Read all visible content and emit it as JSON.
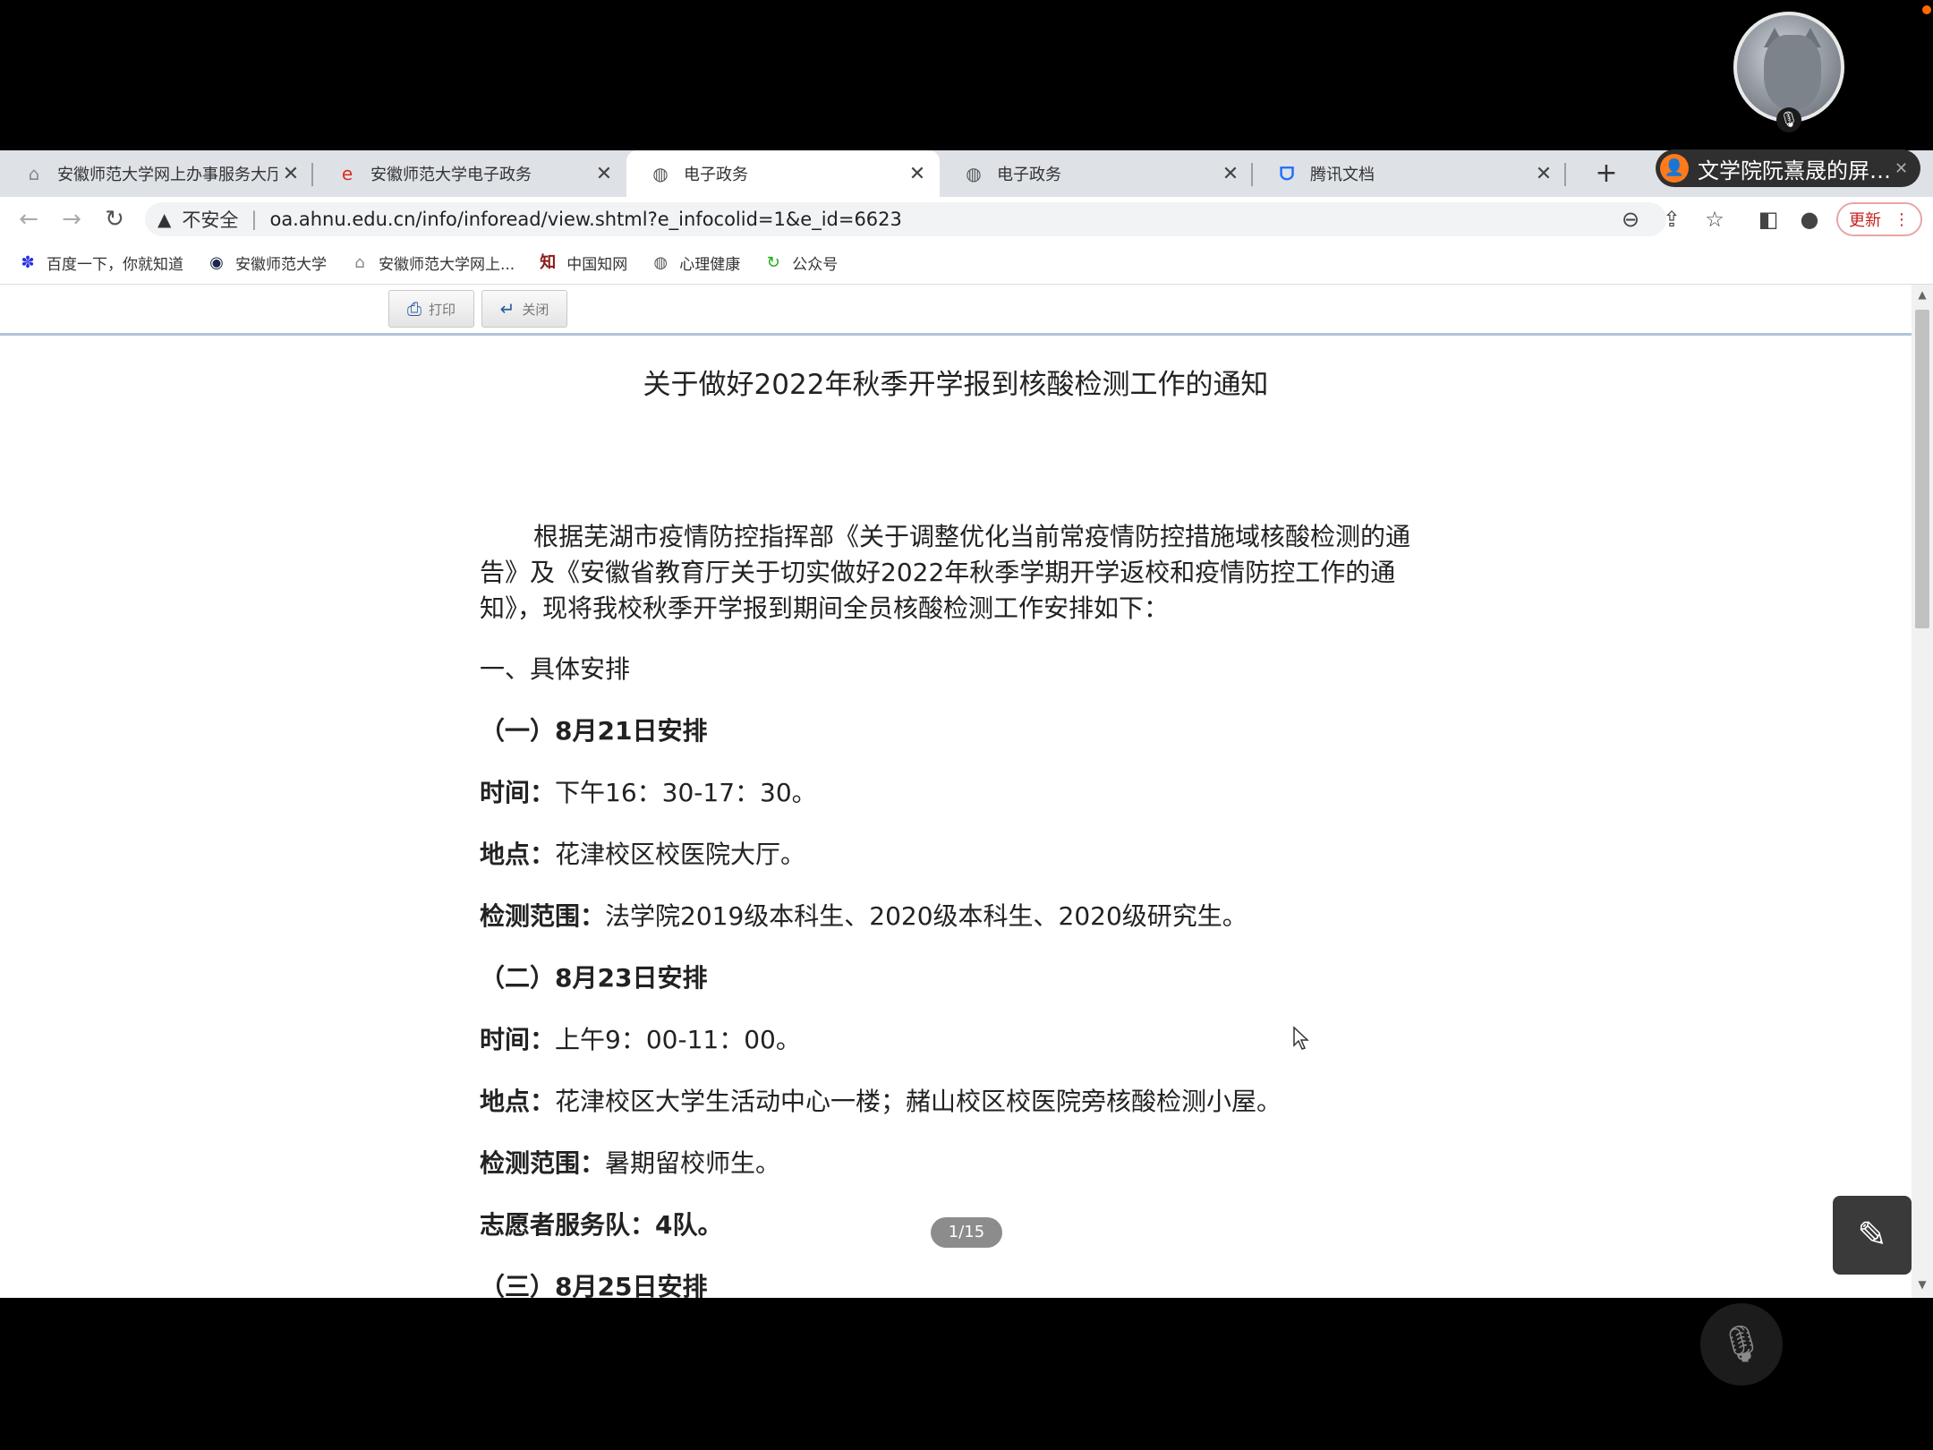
{
  "meeting": {
    "share_label": "文学院阮熹晟的屏…",
    "avatar_alt": "cat avatar",
    "pager": "1/15"
  },
  "tabs": [
    {
      "label": "安徽师范大学网上办事服务大厅",
      "icon": "home-icon",
      "close": "✕"
    },
    {
      "label": "安徽师范大学电子政务",
      "icon": "swirl-logo-icon",
      "close": "✕"
    },
    {
      "label": "电子政务",
      "icon": "globe-icon",
      "close": "✕"
    },
    {
      "label": "电子政务",
      "icon": "globe-icon",
      "close": "✕"
    },
    {
      "label": "腾讯文档",
      "icon": "tencent-docs-icon",
      "close": "✕"
    }
  ],
  "newtab_label": "+",
  "toolbar": {
    "insecure_label": "不安全",
    "url": "oa.ahnu.edu.cn/info/inforead/view.shtml?e_infocolid=1&e_id=6623",
    "update_label": "更新"
  },
  "bookmarks": [
    {
      "label": "百度一下，你就知道",
      "icon": "baidu-paw-icon"
    },
    {
      "label": "安徽师范大学",
      "icon": "university-seal-icon"
    },
    {
      "label": "安徽师范大学网上...",
      "icon": "home-icon"
    },
    {
      "label": "中国知网",
      "icon": "cnki-icon"
    },
    {
      "label": "心理健康",
      "icon": "globe-icon"
    },
    {
      "label": "公众号",
      "icon": "green-swirl-icon"
    }
  ],
  "page": {
    "print_label": "打印",
    "close_label": "关闭",
    "title": "关于做好2022年秋季开学报到核酸检测工作的通知",
    "intro": "根据芜湖市疫情防控指挥部《关于调整优化当前常疫情防控措施域核酸检测的通告》及《安徽省教育厅关于切实做好2022年秋季学期开学返校和疫情防控工作的通知》，现将我校秋季开学报到期间全员核酸检测工作安排如下：",
    "section1": "一、具体安排",
    "s1_head": "（一）8月21日安排",
    "s1_time_label": "时间：",
    "s1_time": "下午16：30-17：30。",
    "s1_place_label": "地点：",
    "s1_place": "花津校区校医院大厅。",
    "s1_scope_label": "检测范围：",
    "s1_scope": "法学院2019级本科生、2020级本科生、2020级研究生。",
    "s2_head": "（二）8月23日安排",
    "s2_time_label": "时间：",
    "s2_time": "上午9：00-11：00。",
    "s2_place_label": "地点：",
    "s2_place": "花津校区大学生活动中心一楼；赭山校区校医院旁核酸检测小屋。",
    "s2_scope_label": "检测范围：",
    "s2_scope": "暑期留校师生。",
    "s2_vol_label": "志愿者服务队：",
    "s2_vol": "4队。",
    "s3_head": "（三）8月25日安排"
  }
}
